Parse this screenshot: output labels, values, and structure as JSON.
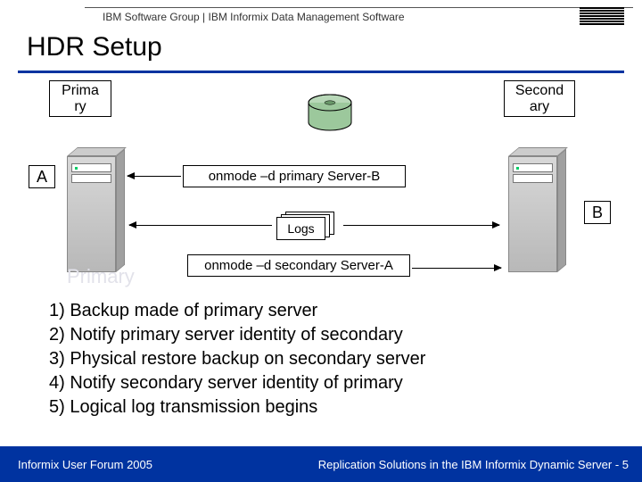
{
  "header": {
    "breadcrumb": "IBM Software Group  |  IBM Informix Data Management Software"
  },
  "title": "HDR Setup",
  "labels": {
    "primary": "Prima\nry",
    "secondary": "Second\nary",
    "tagA": "A",
    "tagB": "B",
    "logs": "Logs",
    "ghost": "Primary"
  },
  "commands": {
    "cmd1": "onmode –d primary Server-B",
    "cmd2": "onmode –d secondary Server-A"
  },
  "steps": [
    "1) Backup made of primary server",
    "2) Notify primary server identity of secondary",
    "3) Physical restore backup on secondary server",
    "4) Notify secondary server identity of primary",
    "5) Logical log transmission begins"
  ],
  "footer": {
    "left": "Informix User Forum 2005",
    "right": "Replication Solutions in the IBM Informix Dynamic Server  -  5"
  }
}
